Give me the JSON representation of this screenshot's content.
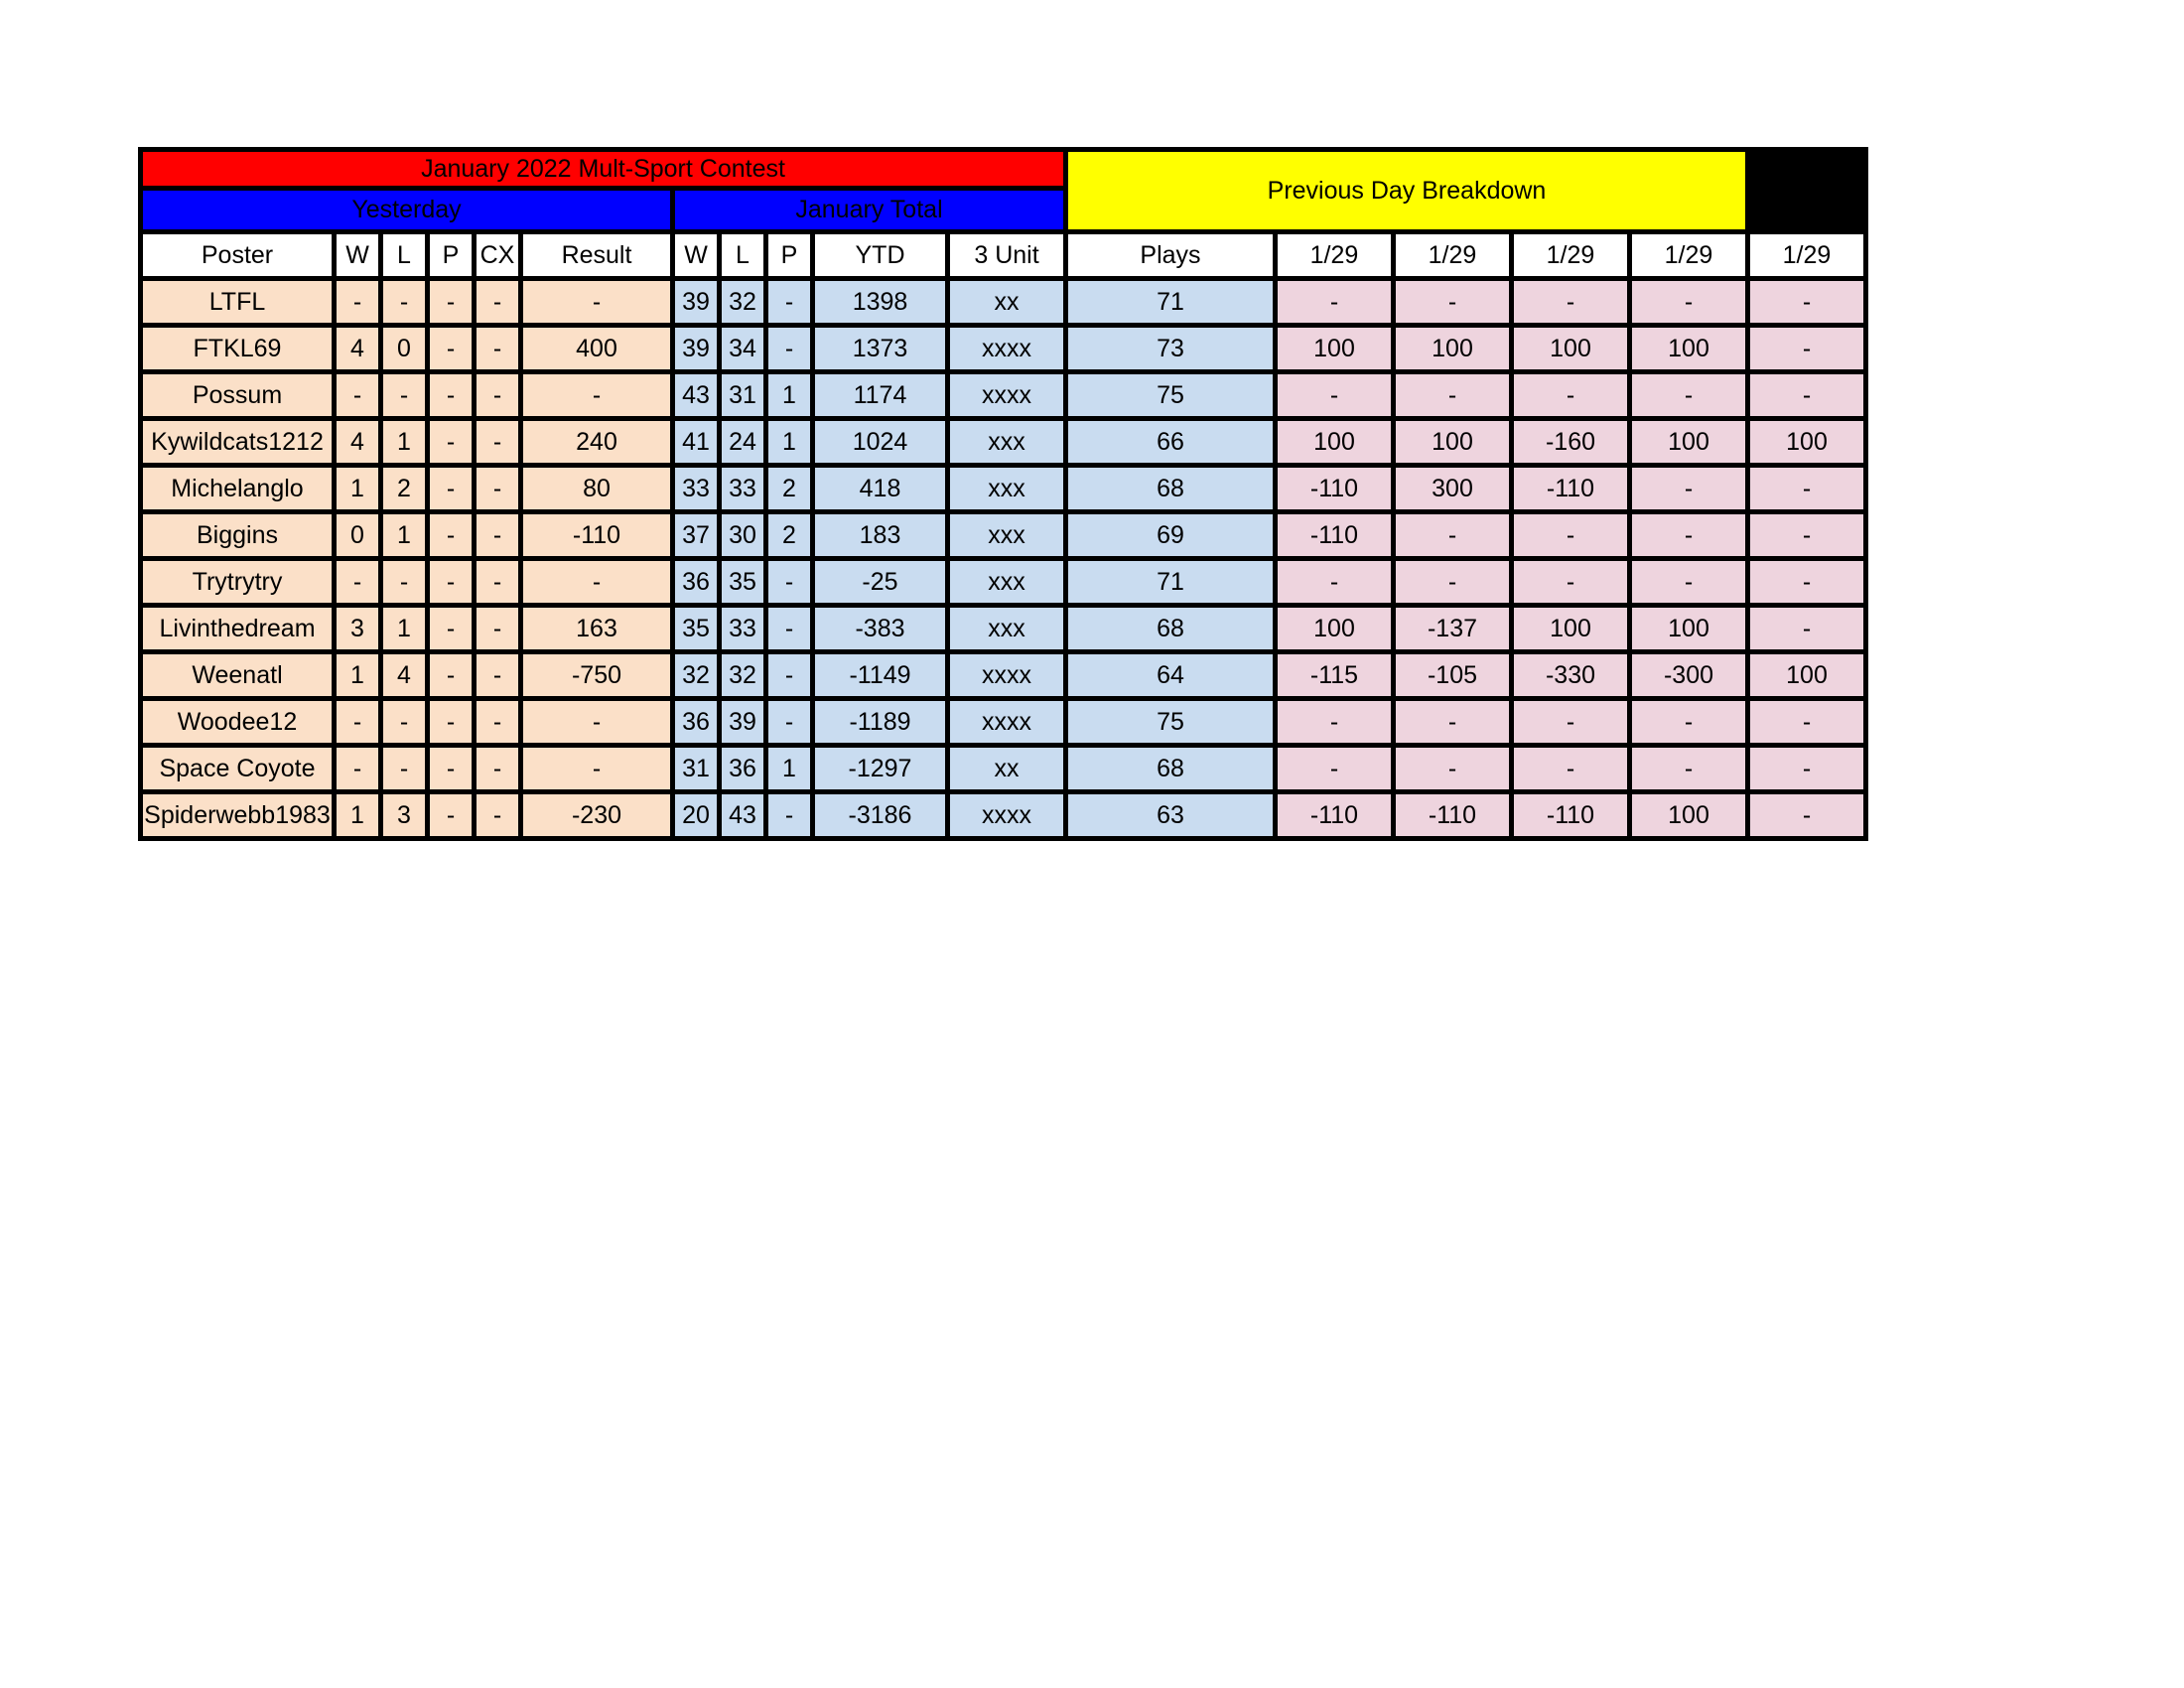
{
  "title_banner": {
    "text": "January 2022 Mult-Sport Contest",
    "color": "#ff0000"
  },
  "group_headers": {
    "yesterday": "Yesterday",
    "january_total": "January Total",
    "previous_day_breakdown": "Previous Day Breakdown",
    "yesterday_color": "#0000ff",
    "january_total_color": "#0000ff",
    "previous_day_color": "#ffff00"
  },
  "columns": {
    "poster": "Poster",
    "yesterday": [
      "W",
      "L",
      "P",
      "CX",
      "Result"
    ],
    "january_total": [
      "W",
      "L",
      "P",
      "YTD",
      "3 Unit",
      "Plays"
    ],
    "breakdown": [
      "1/29",
      "1/29",
      "1/29",
      "1/29",
      "1/29"
    ]
  },
  "section_colors": {
    "yesterday_body": "#fbe0c8",
    "january_total_body": "#c9dcf0",
    "breakdown_body": "#eed4de",
    "header_body": "#ffffff",
    "grid": "#000000"
  },
  "rows": [
    {
      "poster": "LTFL",
      "yesterday": [
        "-",
        "-",
        "-",
        "-",
        "-"
      ],
      "january_total": [
        "39",
        "32",
        "-",
        "1398",
        "xx",
        "71"
      ],
      "breakdown": [
        "-",
        "-",
        "-",
        "-",
        "-"
      ]
    },
    {
      "poster": "FTKL69",
      "yesterday": [
        "4",
        "0",
        "-",
        "-",
        "400"
      ],
      "january_total": [
        "39",
        "34",
        "-",
        "1373",
        "xxxx",
        "73"
      ],
      "breakdown": [
        "100",
        "100",
        "100",
        "100",
        "-"
      ]
    },
    {
      "poster": "Possum",
      "yesterday": [
        "-",
        "-",
        "-",
        "-",
        "-"
      ],
      "january_total": [
        "43",
        "31",
        "1",
        "1174",
        "xxxx",
        "75"
      ],
      "breakdown": [
        "-",
        "-",
        "-",
        "-",
        "-"
      ]
    },
    {
      "poster": "Kywildcats1212",
      "yesterday": [
        "4",
        "1",
        "-",
        "-",
        "240"
      ],
      "january_total": [
        "41",
        "24",
        "1",
        "1024",
        "xxx",
        "66"
      ],
      "breakdown": [
        "100",
        "100",
        "-160",
        "100",
        "100"
      ]
    },
    {
      "poster": "Michelanglo",
      "yesterday": [
        "1",
        "2",
        "-",
        "-",
        "80"
      ],
      "january_total": [
        "33",
        "33",
        "2",
        "418",
        "xxx",
        "68"
      ],
      "breakdown": [
        "-110",
        "300",
        "-110",
        "-",
        "-"
      ]
    },
    {
      "poster": "Biggins",
      "yesterday": [
        "0",
        "1",
        "-",
        "-",
        "-110"
      ],
      "january_total": [
        "37",
        "30",
        "2",
        "183",
        "xxx",
        "69"
      ],
      "breakdown": [
        "-110",
        "-",
        "-",
        "-",
        "-"
      ]
    },
    {
      "poster": "Trytrytry",
      "yesterday": [
        "-",
        "-",
        "-",
        "-",
        "-"
      ],
      "january_total": [
        "36",
        "35",
        "-",
        "-25",
        "xxx",
        "71"
      ],
      "breakdown": [
        "-",
        "-",
        "-",
        "-",
        "-"
      ]
    },
    {
      "poster": "Livinthedream",
      "yesterday": [
        "3",
        "1",
        "-",
        "-",
        "163"
      ],
      "january_total": [
        "35",
        "33",
        "-",
        "-383",
        "xxx",
        "68"
      ],
      "breakdown": [
        "100",
        "-137",
        "100",
        "100",
        "-"
      ]
    },
    {
      "poster": "Weenatl",
      "yesterday": [
        "1",
        "4",
        "-",
        "-",
        "-750"
      ],
      "january_total": [
        "32",
        "32",
        "-",
        "-1149",
        "xxxx",
        "64"
      ],
      "breakdown": [
        "-115",
        "-105",
        "-330",
        "-300",
        "100"
      ]
    },
    {
      "poster": "Woodee12",
      "yesterday": [
        "-",
        "-",
        "-",
        "-",
        "-"
      ],
      "january_total": [
        "36",
        "39",
        "-",
        "-1189",
        "xxxx",
        "75"
      ],
      "breakdown": [
        "-",
        "-",
        "-",
        "-",
        "-"
      ]
    },
    {
      "poster": "Space Coyote",
      "yesterday": [
        "-",
        "-",
        "-",
        "-",
        "-"
      ],
      "january_total": [
        "31",
        "36",
        "1",
        "-1297",
        "xx",
        "68"
      ],
      "breakdown": [
        "-",
        "-",
        "-",
        "-",
        "-"
      ]
    },
    {
      "poster": "Spiderwebb1983",
      "yesterday": [
        "1",
        "3",
        "-",
        "-",
        "-230"
      ],
      "january_total": [
        "20",
        "43",
        "-",
        "-3186",
        "xxxx",
        "63"
      ],
      "breakdown": [
        "-110",
        "-110",
        "-110",
        "100",
        "-"
      ]
    }
  ]
}
